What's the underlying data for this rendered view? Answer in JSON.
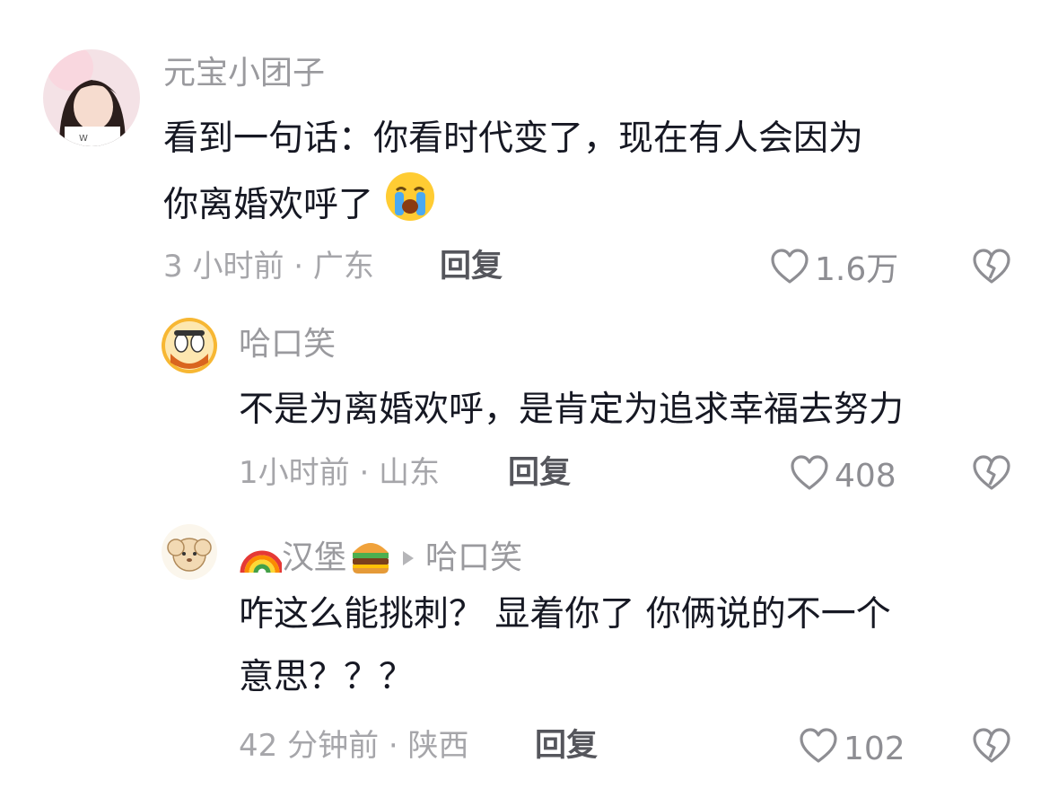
{
  "comments": [
    {
      "username": "元宝小团子",
      "text_line1": "看到一句话：你看时代变了，现在有人会因为",
      "text_line2": "你离婚欢呼了",
      "text_emoji": "crying-face-emoji",
      "meta": "3 小时前 · 广东",
      "reply_label": "回复",
      "likes": "1.6万"
    },
    {
      "username": "哈口笑",
      "text_line1": "不是为离婚欢呼，是肯定为追求幸福去努力",
      "meta": "1小时前 · 山东",
      "reply_label": "回复",
      "likes": "408"
    },
    {
      "username": "汉堡",
      "username_prefix_emoji": "rainbow-emoji",
      "username_suffix_emoji": "hamburger-emoji",
      "reply_to": "哈口笑",
      "text_line1": "咋这么能挑刺？ 显着你了 你俩说的不一个",
      "text_line2": "意思？？？",
      "meta": "42 分钟前 · 陕西",
      "reply_label": "回复",
      "likes": "102"
    }
  ],
  "icons": {
    "like": "heart-outline-icon",
    "dislike": "broken-heart-icon",
    "reply_arrow": "triangle-right-icon"
  },
  "colors": {
    "text": "#161823",
    "meta": "#a6a6aa",
    "name": "#9a9a9e"
  }
}
